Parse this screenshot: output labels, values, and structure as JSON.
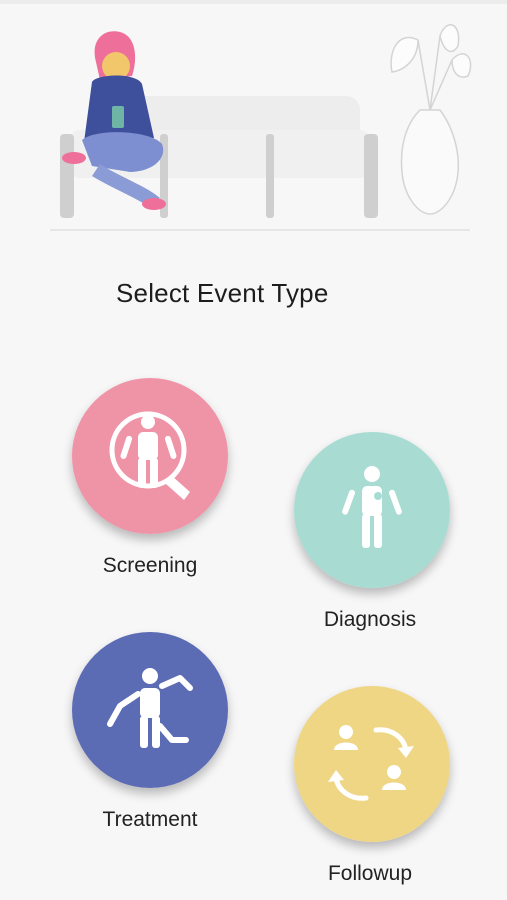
{
  "page": {
    "title": "Select Event Type"
  },
  "events": [
    {
      "label": "Screening",
      "color": "#ef93a7",
      "icon": "person-magnifier-icon"
    },
    {
      "label": "Diagnosis",
      "color": "#a8dcd3",
      "icon": "person-with-marker-icon"
    },
    {
      "label": "Treatment",
      "color": "#5b6bb4",
      "icon": "person-with-branches-icon"
    },
    {
      "label": "Followup",
      "color": "#efd685",
      "icon": "people-cycle-arrows-icon"
    }
  ],
  "illustration": {
    "icon": "woman-on-sofa-illustration"
  }
}
